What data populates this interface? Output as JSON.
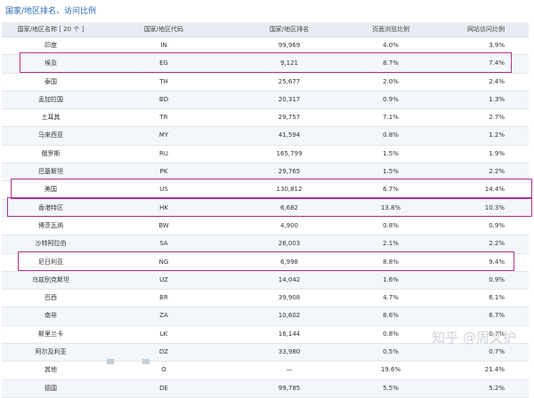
{
  "title": "国家/地区排名、访问比例",
  "headers": [
    "国家/地区名称 [ 20 个 ]",
    "国家/地区代码",
    "国家/地区排名",
    "页面浏览比例",
    "网站访问比例"
  ],
  "rows": [
    [
      "印度",
      "IN",
      "99,969",
      "4.0%",
      "3.9%"
    ],
    [
      "埃及",
      "EG",
      "9,121",
      "8.7%",
      "7.4%"
    ],
    [
      "泰国",
      "TH",
      "25,677",
      "2.0%",
      "2.4%"
    ],
    [
      "孟加拉国",
      "BD",
      "20,317",
      "0.9%",
      "1.3%"
    ],
    [
      "土耳其",
      "TR",
      "29,757",
      "7.1%",
      "2.7%"
    ],
    [
      "马来西亚",
      "MY",
      "41,594",
      "0.8%",
      "1.2%"
    ],
    [
      "俄罗斯",
      "RU",
      "165,799",
      "1.5%",
      "1.9%"
    ],
    [
      "巴基斯坦",
      "PK",
      "29,765",
      "1.5%",
      "2.2%"
    ],
    [
      "美国",
      "US",
      "130,812",
      "6.7%",
      "14.4%"
    ],
    [
      "香港特区",
      "HK",
      "6,682",
      "13.8%",
      "10.3%"
    ],
    [
      "博茨瓦纳",
      "BW",
      "4,900",
      "0.8%",
      "0.9%"
    ],
    [
      "沙特阿拉伯",
      "SA",
      "26,003",
      "2.1%",
      "2.2%"
    ],
    [
      "尼日利亚",
      "NG",
      "6,998",
      "8.8%",
      "9.4%"
    ],
    [
      "乌兹别克斯坦",
      "UZ",
      "14,042",
      "1.6%",
      "0.9%"
    ],
    [
      "巴西",
      "BR",
      "39,908",
      "4.7%",
      "6.1%"
    ],
    [
      "南非",
      "ZA",
      "10,602",
      "8.6%",
      "6.7%"
    ],
    [
      "斯里兰卡",
      "LK",
      "16,144",
      "0.8%",
      "0.7%"
    ],
    [
      "阿尔及利亚",
      "DZ",
      "33,980",
      "0.5%",
      "0.7%"
    ],
    [
      "其他",
      "O",
      "—",
      "19.6%",
      "21.4%"
    ],
    [
      "德国",
      "DE",
      "99,785",
      "5.5%",
      "5.2%"
    ]
  ],
  "highlighted_rows": [
    "埃及",
    "美国",
    "香港特区",
    "尼日利亚"
  ],
  "watermark": "知乎 @周文护",
  "colors": {
    "highlight": "#b0338e",
    "title": "#2a6ab1",
    "header_bg": "#e8edf3"
  }
}
